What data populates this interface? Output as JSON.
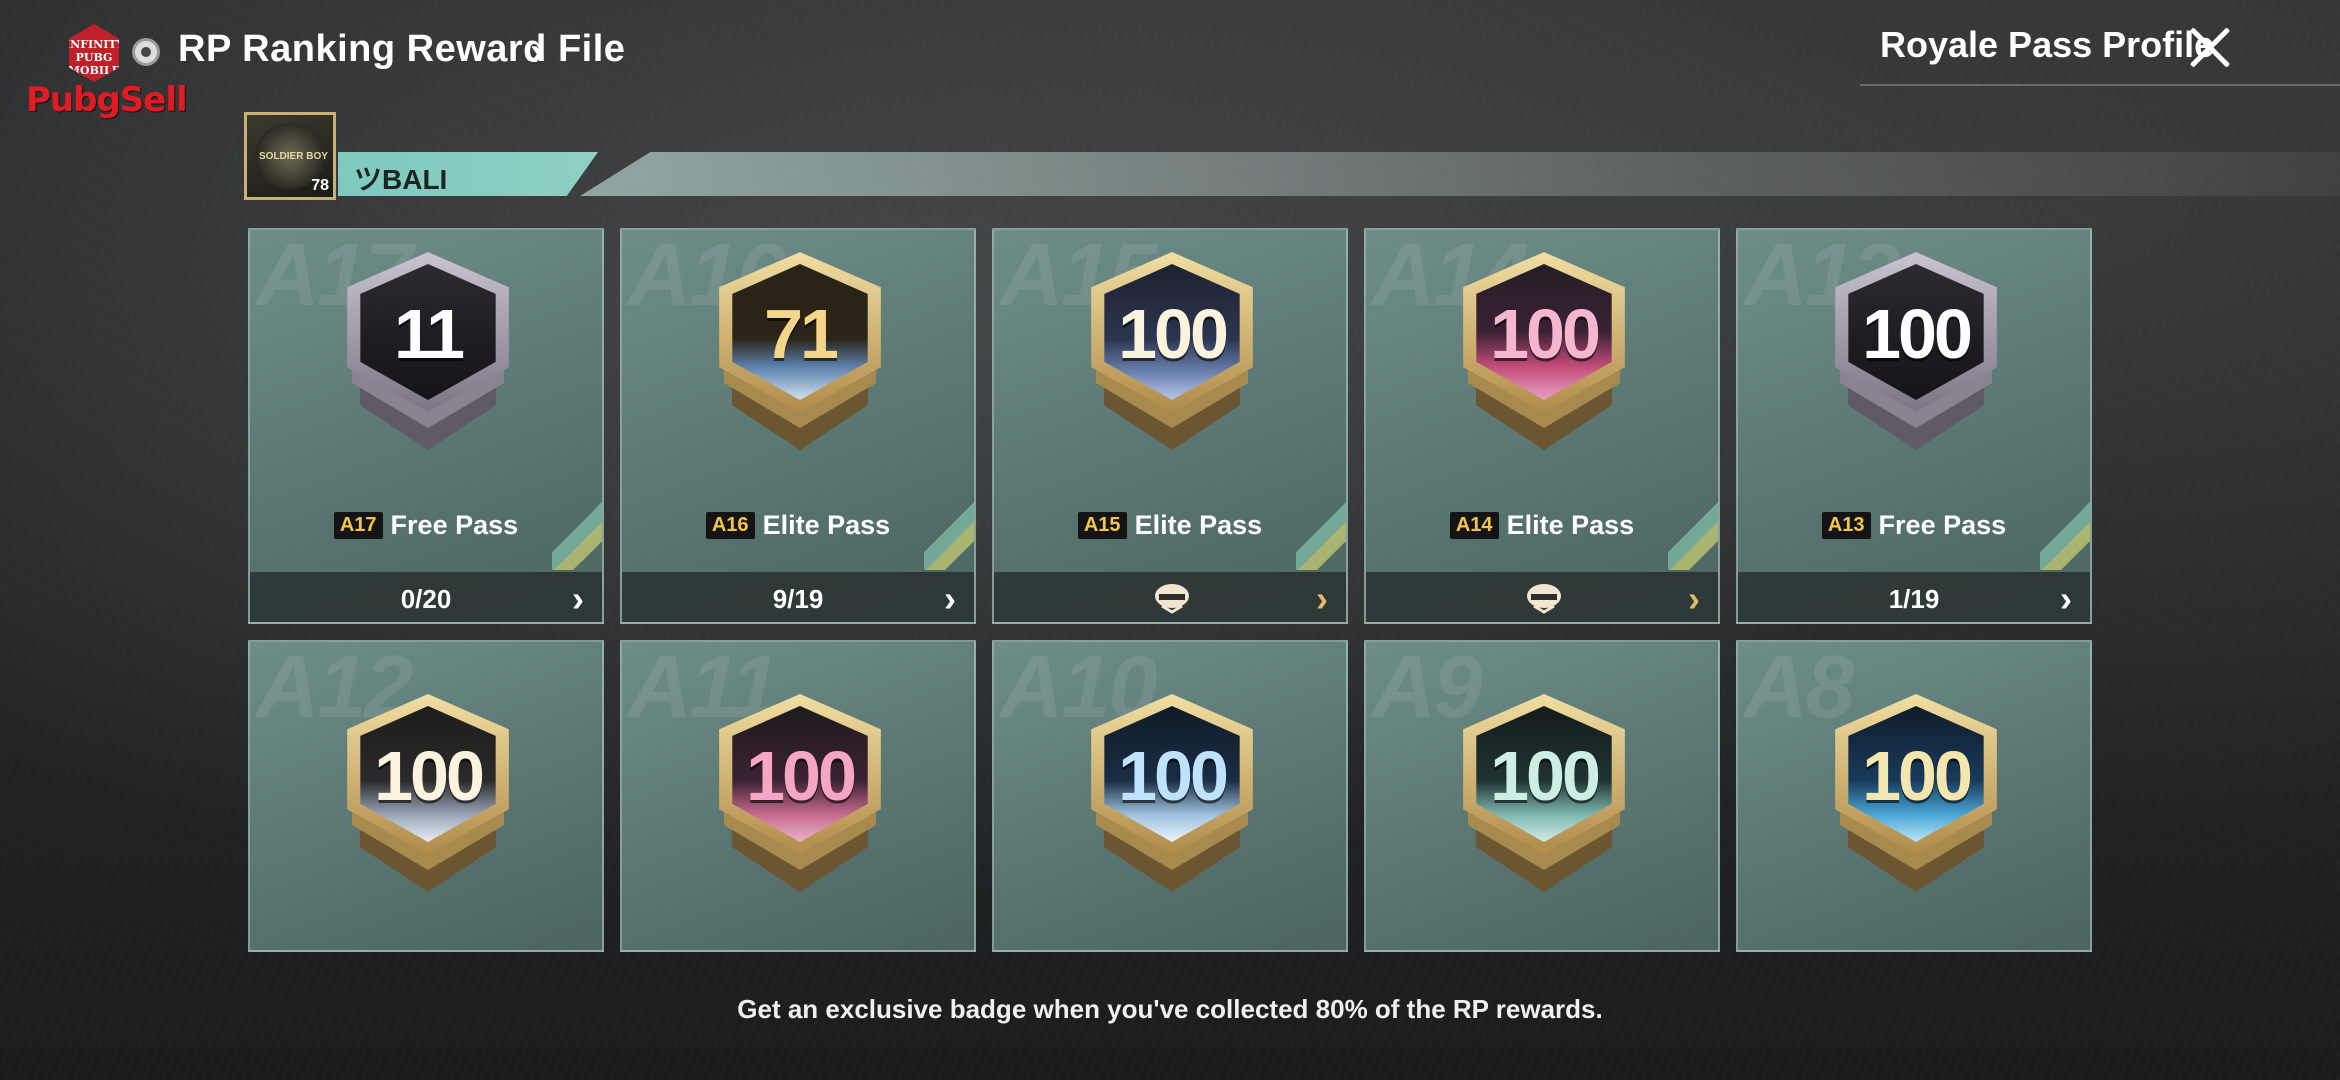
{
  "header": {
    "logo_text": "INFINITY PUBG MOBILE",
    "brand": "PubgSell",
    "title": "RP Ranking Reward File",
    "title_chevron": "›",
    "profile_link": "Royale Pass Profile",
    "close_icon": "close-icon"
  },
  "player": {
    "avatar_tag": "SOLDIER BOY",
    "level": "78",
    "name": "ツBALI"
  },
  "seasons": [
    {
      "watermark": "A17",
      "chip": "A17",
      "pass": "Free Pass",
      "badge_value": "11",
      "badge_style": "silver",
      "progress": "0/20",
      "footer_icon": "",
      "chevron_color": "white"
    },
    {
      "watermark": "A16",
      "chip": "A16",
      "pass": "Elite Pass",
      "badge_value": "71",
      "badge_style": "gold",
      "progress": "9/19",
      "footer_icon": "",
      "chevron_color": "white"
    },
    {
      "watermark": "A15",
      "chip": "A15",
      "pass": "Elite Pass",
      "badge_value": "100",
      "badge_style": "gold",
      "progress": "",
      "footer_icon": "helmet-icon",
      "chevron_color": "gold"
    },
    {
      "watermark": "A14",
      "chip": "A14",
      "pass": "Elite Pass",
      "badge_value": "100",
      "badge_style": "gold",
      "progress": "",
      "footer_icon": "helmet-icon",
      "chevron_color": "gold"
    },
    {
      "watermark": "A13",
      "chip": "A13",
      "pass": "Free Pass",
      "badge_value": "100",
      "badge_style": "silver",
      "progress": "1/19",
      "footer_icon": "",
      "chevron_color": "white"
    },
    {
      "watermark": "A12",
      "badge_value": "100",
      "badge_style": "gold"
    },
    {
      "watermark": "A11",
      "badge_value": "100",
      "badge_style": "gold"
    },
    {
      "watermark": "A10",
      "badge_value": "100",
      "badge_style": "gold"
    },
    {
      "watermark": "A9",
      "badge_value": "100",
      "badge_style": "gold"
    },
    {
      "watermark": "A8",
      "badge_value": "100",
      "badge_style": "gold"
    }
  ],
  "footer_note": "Get an exclusive badge when you've collected 80% of the RP rewards.",
  "colors": {
    "accent_teal": "#7fc9bf",
    "chip_gold": "#f3c64a",
    "card_bg": "#6e8d89"
  }
}
